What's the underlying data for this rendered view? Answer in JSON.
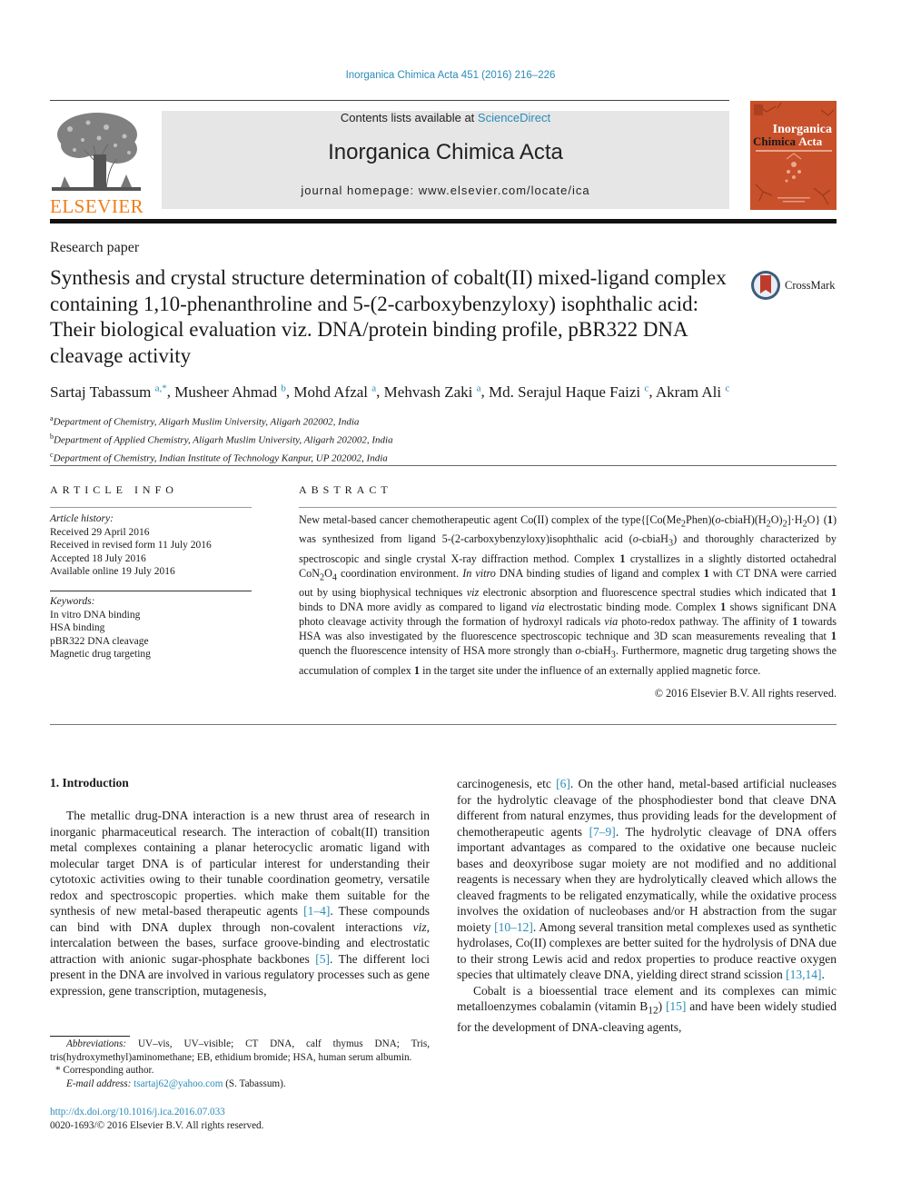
{
  "header": {
    "journal_ref": "Inorganica Chimica Acta 451 (2016) 216–226",
    "contents_prefix": "Contents lists available at ",
    "contents_link": "ScienceDirect",
    "journal_title": "Inorganica Chimica Acta",
    "homepage": "journal homepage: www.elsevier.com/locate/ica",
    "publisher_logo": "ELSEVIER",
    "cover_title_1": "Inorganica",
    "cover_title_2a": "Chimica",
    "cover_title_2b": "Acta",
    "crossmark_label": "CrossMark"
  },
  "article": {
    "type": "Research paper",
    "title": "Synthesis and crystal structure determination of cobalt(II) mixed-ligand complex containing 1,10-phenanthroline and 5-(2-carboxybenzyloxy) isophthalic acid: Their biological evaluation viz. DNA/protein binding profile, pBR322 DNA cleavage activity",
    "authors": [
      {
        "name": "Sartaj Tabassum",
        "sup": "a,*"
      },
      {
        "name": "Musheer Ahmad",
        "sup": "b"
      },
      {
        "name": "Mohd Afzal",
        "sup": "a"
      },
      {
        "name": "Mehvash Zaki",
        "sup": "a"
      },
      {
        "name": "Md. Serajul Haque Faizi",
        "sup": "c"
      },
      {
        "name": "Akram Ali",
        "sup": "c"
      }
    ],
    "affiliations": [
      {
        "sup": "a",
        "text": "Department of Chemistry, Aligarh Muslim University, Aligarh 202002, India"
      },
      {
        "sup": "b",
        "text": "Department of Applied Chemistry, Aligarh Muslim University, Aligarh 202002, India"
      },
      {
        "sup": "c",
        "text": "Department of Chemistry, Indian Institute of Technology Kanpur, UP 202002, India"
      }
    ]
  },
  "article_info": {
    "heading": "ARTICLE INFO",
    "history_label": "Article history:",
    "history": [
      "Received 29 April 2016",
      "Received in revised form 11 July 2016",
      "Accepted 18 July 2016",
      "Available online 19 July 2016"
    ],
    "keywords_label": "Keywords:",
    "keywords": [
      "In vitro DNA binding",
      "HSA binding",
      "pBR322 DNA cleavage",
      "Magnetic drug targeting"
    ]
  },
  "abstract": {
    "heading": "ABSTRACT",
    "p1": "New metal-based cancer chemotherapeutic agent Co(II) complex of the type{[Co(Me",
    "p2": "Phen)(",
    "p3": "o",
    "p4": "-cbiaH)(H",
    "p5": "O)",
    "p6": "]·H",
    "p7": "O} (",
    "p8": "1",
    "p9": ") was synthesized from ligand 5-(2-carboxybenzyloxy)isophthalic acid (",
    "p10": "-cbiaH",
    "p11": ") and thoroughly characterized by spectroscopic and single crystal X-ray diffraction method. Complex ",
    "p12": " crystallizes in a slightly distorted octahedral CoN",
    "p13": "O",
    "p14": " coordination environment. ",
    "p15": "In vitro",
    "p16": " DNA binding studies of ligand and complex ",
    "p17": " with CT DNA were carried out by using biophysical techniques ",
    "p18": "viz",
    "p19": " electronic absorption and fluorescence spectral studies which indicated that ",
    "p20": " binds to DNA more avidly as compared to ligand ",
    "p21": "via",
    "p22": " electrostatic binding mode. Complex ",
    "p23": " shows significant DNA photo cleavage activity through the formation of hydroxyl radicals ",
    "p24": " photo-redox pathway. The affinity of ",
    "p25": " towards HSA was also investigated by the fluorescence spectroscopic technique and 3D scan measurements revealing that ",
    "p26": " quench the fluorescence intensity of HSA more strongly than ",
    "p27": ". Furthermore, magnetic drug targeting shows the accumulation of complex ",
    "p28": " in the target site under the influence of an externally applied magnetic force.",
    "sub2": "2",
    "sub3": "3",
    "sub4": "4",
    "copyright": "© 2016 Elsevier B.V. All rights reserved."
  },
  "intro": {
    "heading": "1. Introduction",
    "left": {
      "t1": "The metallic drug-DNA interaction is a new thrust area of research in inorganic pharmaceutical research. The interaction of cobalt(II) transition metal complexes containing a planar heterocyclic aromatic ligand with molecular target DNA is of particular interest for understanding their cytotoxic activities owing to their tunable coordination geometry, versatile redox and spectroscopic properties. which make them suitable for the synthesis of new metal-based therapeutic agents ",
      "r1": "[1–4]",
      "t2": ". These compounds can bind with DNA duplex through non-covalent interactions ",
      "viz": "viz",
      "t3": ", intercalation between the bases, surface groove-binding and electrostatic attraction with anionic sugar-phosphate backbones ",
      "r2": "[5]",
      "t4": ". The different loci present in the DNA are involved in various regulatory processes such as gene expression, gene transcription, mutagenesis,"
    },
    "right": {
      "t1": "carcinogenesis, etc ",
      "r1": "[6]",
      "t2": ". On the other hand, metal-based artificial nucleases for the hydrolytic cleavage of the phosphodiester bond that cleave DNA different from natural enzymes, thus providing leads for the development of chemotherapeutic agents ",
      "r2": "[7–9]",
      "t3": ". The hydrolytic cleavage of DNA offers important advantages as compared to the oxidative one because nucleic bases and deoxyribose sugar moiety are not modified and no additional reagents is necessary when they are hydrolytically cleaved which allows the cleaved fragments to be religated enzymatically, while the oxidative process involves the oxidation of nucleobases and/or H abstraction from the sugar moiety ",
      "r3": "[10–12]",
      "t4": ". Among several transition metal complexes used as synthetic hydrolases, Co(II) complexes are better suited for the hydrolysis of DNA due to their strong Lewis acid and redox properties to produce reactive oxygen species that ultimately cleave DNA, yielding direct strand scission ",
      "r4": "[13,14]",
      "t5": ".",
      "p2a": "Cobalt is a bioessential trace element and its complexes can mimic metalloenzymes cobalamin (vitamin B",
      "p2sub": "12",
      "p2b": ") ",
      "r5": "[15]",
      "p2c": " and have been widely studied for the development of DNA-cleaving agents,"
    }
  },
  "footnotes": {
    "abbr_label": "Abbreviations:",
    "abbr_text": " UV–vis, UV–visible; CT DNA, calf thymus DNA; Tris, tris(hydroxymethyl)aminomethane; EB, ethidium bromide; HSA, human serum albumin.",
    "corr_mark": "*",
    "corr_text": " Corresponding author.",
    "email_label": "E-mail address:",
    "email": "tsartaj62@yahoo.com",
    "email_suffix": " (S. Tabassum).",
    "doi": "http://dx.doi.org/10.1016/j.ica.2016.07.033",
    "issn": "0020-1693/© 2016 Elsevier B.V. All rights reserved."
  }
}
